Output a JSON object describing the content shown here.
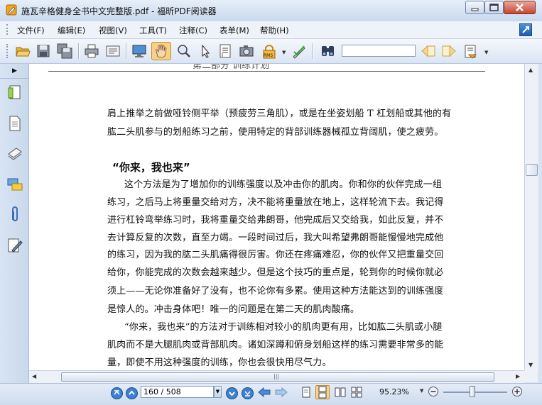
{
  "window": {
    "title": "施瓦辛格健身全书中文完整版.pdf - 福昕PDF阅读器"
  },
  "menu": [
    "文件(F)",
    "编辑(E)",
    "视图(V)",
    "工具(T)",
    "注释(C)",
    "表单(M)",
    "帮助(H)"
  ],
  "toolbar": {
    "icons": [
      "open-icon",
      "save-icon",
      "save-all-icon",
      "print-icon",
      "properties-icon",
      "fullscreen-icon",
      "hand-tool-icon",
      "zoom-tool-icon",
      "select-tool-icon",
      "text-select-icon",
      "snapshot-icon",
      "rms-icon",
      "sign-icon",
      "find-icon",
      "find-prev-icon",
      "find-next-icon",
      "annotation-summary-icon"
    ],
    "search_value": ""
  },
  "nav_icons": [
    "bookmarks-icon",
    "pages-icon",
    "layers-icon",
    "comments-icon",
    "attachments-icon",
    "signatures-icon"
  ],
  "document": {
    "running_head": "第二部分  训练计划",
    "paragraph1": [
      "肩上推举之前做哑铃侧平举（预疲劳三角肌），或是在坐姿划船 T 杠划船或其他的有",
      "肱二头肌参与的划船练习之前，使用特定的背部训练器械孤立背阔肌，使之疲劳。"
    ],
    "heading": "“你来，我也来”",
    "paragraph2": [
      "这个方法是为了增加你的训练强度以及冲击你的肌肉。你和你的伙伴完成一组",
      "练习，之后马上将重量交给对方，决不能将重量放在地上，这样轮流下去。我记得",
      "进行杠铃弯举练习时，我将重量交给弗朗哥，他完成后又交给我，如此反复，并不",
      "去计算反复的次数，直至力竭。一段时间过后，我大叫希望弗朗哥能慢慢地完成他",
      "的练习，因为我的肱二头肌痛得很厉害。你还在疼痛难忍，你的伙伴又把重量交回",
      "给你，你能完成的次数会越来越少。但是这个技巧的重点是，轮到你的时候你就必",
      "须上——无论你准备好了没有，也不论你有多累。使用这种方法能达到的训练强度",
      "是惊人的。冲击身体吧！唯一的问题是在第二天的肌肉酸痛。"
    ],
    "paragraph3": [
      "“你来，我也来”的方法对于训练相对较小的肌肉更有用，比如肱二头肌或小腿",
      "肌肉而不是大腿肌肉或背部肌肉。诸如深蹲和俯身划船这样的练习需要非常多的能",
      "量，即使不用这种强度的训练，你也会很快用尽气力。"
    ]
  },
  "status": {
    "page_field": "160 / 508",
    "zoom": "95.23%",
    "zoom_slider_fraction": 0.45
  }
}
